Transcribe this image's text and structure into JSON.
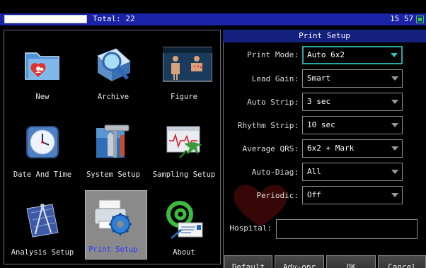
{
  "status_bar": {
    "total_text": "Total: 22",
    "clock": "15 57",
    "battery_color": "#3ecb3e"
  },
  "menu": {
    "items": [
      {
        "label": "New",
        "icon": "folder-heart-icon"
      },
      {
        "label": "Archive",
        "icon": "archive-search-icon"
      },
      {
        "label": "Figure",
        "icon": "figure-icon"
      },
      {
        "label": "Date And Time",
        "icon": "clock-icon"
      },
      {
        "label": "System Setup",
        "icon": "tools-icon"
      },
      {
        "label": "Sampling Setup",
        "icon": "sampling-icon"
      },
      {
        "label": "Analysis Setup",
        "icon": "compass-icon"
      },
      {
        "label": "Print Setup",
        "icon": "printer-gear-icon",
        "selected": true
      },
      {
        "label": "About",
        "icon": "email-at-icon"
      }
    ]
  },
  "print_setup": {
    "title": "Print Setup",
    "fields": [
      {
        "label": "Print Mode:",
        "value": "Auto 6x2"
      },
      {
        "label": "Lead Gain:",
        "value": "Smart"
      },
      {
        "label": "Auto Strip:",
        "value": "3 sec"
      },
      {
        "label": "Rhythm Strip:",
        "value": "10 sec"
      },
      {
        "label": "Average QRS:",
        "value": "6x2 + Mark"
      },
      {
        "label": "Auto-Diag:",
        "value": "All"
      },
      {
        "label": "Periodic:",
        "value": "Off"
      }
    ],
    "hospital_label": "Hospital:",
    "hospital_value": "",
    "buttons": {
      "default": "Default",
      "adv_opr": "Adv-opr",
      "ok": "OK",
      "cancel": "Cancel"
    }
  },
  "colors": {
    "title_bar": "#14207e",
    "status_strip": "#1a22a6",
    "accent": "#2fa6a6",
    "selected_label": "#2f38ff"
  }
}
